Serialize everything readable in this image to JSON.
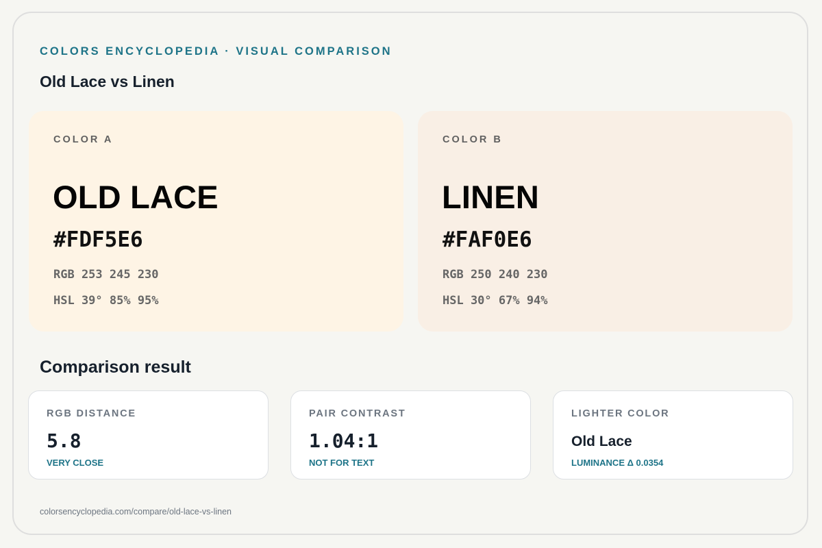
{
  "header": {
    "eyebrow": "COLORS ENCYCLOPEDIA · VISUAL COMPARISON",
    "title": "Old Lace vs Linen"
  },
  "colors": [
    {
      "label": "COLOR A",
      "name": "OLD LACE",
      "hex": "#FDF5E6",
      "rgb": "RGB 253 245 230",
      "hsl": "HSL 39° 85% 95%",
      "swatch_color": "#fef4e5"
    },
    {
      "label": "COLOR B",
      "name": "LINEN",
      "hex": "#FAF0E6",
      "rgb": "RGB 250 240 230",
      "hsl": "HSL 30° 67% 94%",
      "swatch_color": "#f9efe5"
    }
  ],
  "comparison": {
    "title": "Comparison result",
    "cards": [
      {
        "label": "RGB DISTANCE",
        "value": "5.8",
        "note": "VERY CLOSE"
      },
      {
        "label": "PAIR CONTRAST",
        "value": "1.04:1",
        "note": "NOT FOR TEXT"
      },
      {
        "label": "LIGHTER COLOR",
        "value": "Old Lace",
        "note": "LUMINANCE Δ 0.0354"
      }
    ]
  },
  "footer": {
    "url": "colorsencyclopedia.com/compare/old-lace-vs-linen"
  },
  "theme": {
    "accent": "#1e7488",
    "background": "#f6f6f2"
  }
}
